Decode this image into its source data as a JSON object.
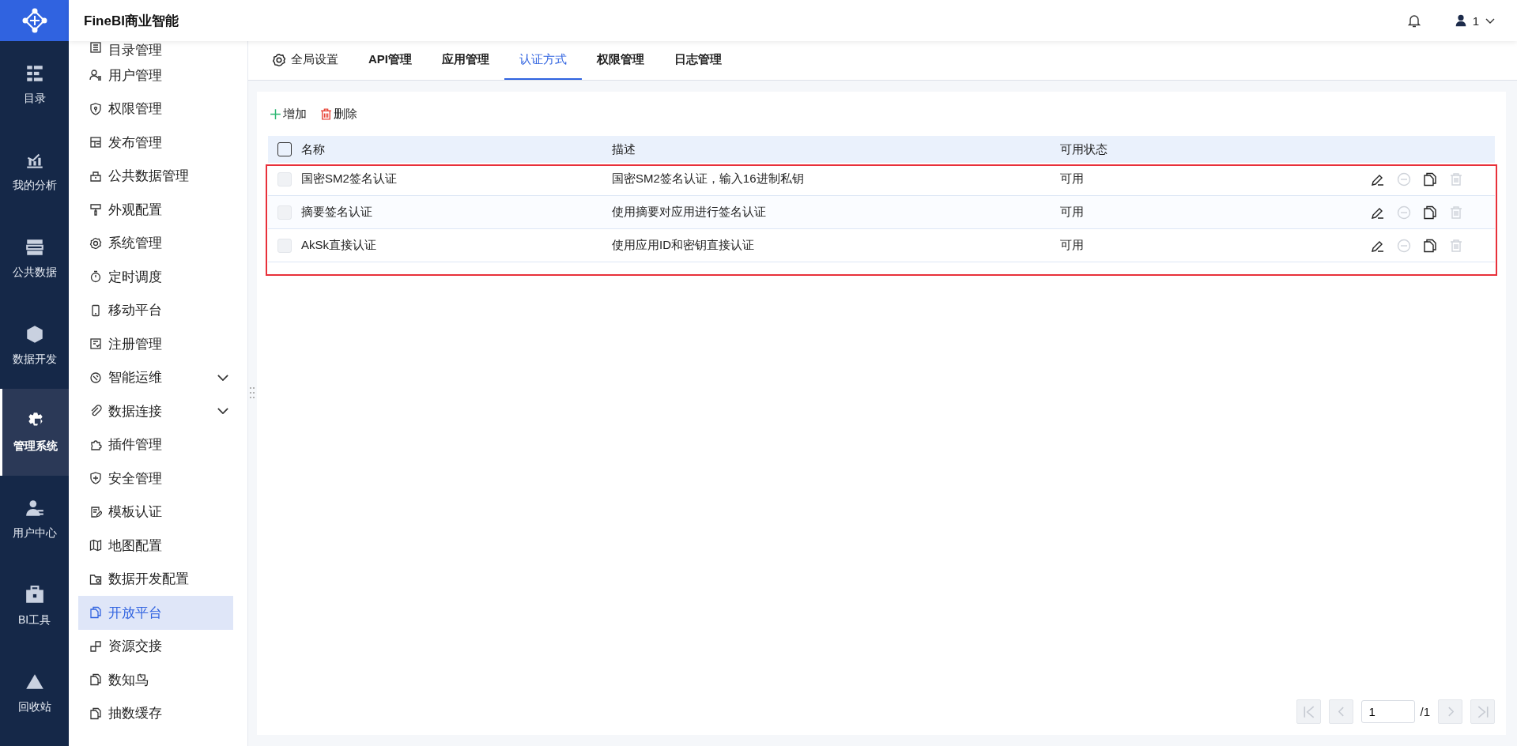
{
  "app": {
    "title": "FineBI商业智能"
  },
  "header": {
    "user": "1"
  },
  "rail": [
    {
      "label": "目录",
      "selected": false
    },
    {
      "label": "我的分析",
      "selected": false
    },
    {
      "label": "公共数据",
      "selected": false
    },
    {
      "label": "数据开发",
      "selected": false
    },
    {
      "label": "管理系统",
      "selected": true
    },
    {
      "label": "用户中心",
      "selected": false
    },
    {
      "label": "BI工具",
      "selected": false
    },
    {
      "label": "回收站",
      "selected": false
    }
  ],
  "menu": [
    {
      "label": "目录管理",
      "selected": false,
      "expandable": false
    },
    {
      "label": "用户管理",
      "selected": false,
      "expandable": false
    },
    {
      "label": "权限管理",
      "selected": false,
      "expandable": false
    },
    {
      "label": "发布管理",
      "selected": false,
      "expandable": false
    },
    {
      "label": "公共数据管理",
      "selected": false,
      "expandable": false
    },
    {
      "label": "外观配置",
      "selected": false,
      "expandable": false
    },
    {
      "label": "系统管理",
      "selected": false,
      "expandable": false
    },
    {
      "label": "定时调度",
      "selected": false,
      "expandable": false
    },
    {
      "label": "移动平台",
      "selected": false,
      "expandable": false
    },
    {
      "label": "注册管理",
      "selected": false,
      "expandable": false
    },
    {
      "label": "智能运维",
      "selected": false,
      "expandable": true
    },
    {
      "label": "数据连接",
      "selected": false,
      "expandable": true
    },
    {
      "label": "插件管理",
      "selected": false,
      "expandable": false
    },
    {
      "label": "安全管理",
      "selected": false,
      "expandable": false
    },
    {
      "label": "模板认证",
      "selected": false,
      "expandable": false
    },
    {
      "label": "地图配置",
      "selected": false,
      "expandable": false
    },
    {
      "label": "数据开发配置",
      "selected": false,
      "expandable": false
    },
    {
      "label": "开放平台",
      "selected": true,
      "expandable": false
    },
    {
      "label": "资源交接",
      "selected": false,
      "expandable": false
    },
    {
      "label": "数知鸟",
      "selected": false,
      "expandable": false
    },
    {
      "label": "抽数缓存",
      "selected": false,
      "expandable": false
    }
  ],
  "tabs": [
    {
      "label": "全局设置",
      "kind": "settings",
      "selected": false
    },
    {
      "label": "API管理",
      "kind": "plain",
      "selected": false
    },
    {
      "label": "应用管理",
      "kind": "plain",
      "selected": false
    },
    {
      "label": "认证方式",
      "kind": "plain",
      "selected": true
    },
    {
      "label": "权限管理",
      "kind": "plain",
      "selected": false
    },
    {
      "label": "日志管理",
      "kind": "plain",
      "selected": false
    }
  ],
  "toolbar": [
    {
      "label": "增加",
      "kind": "add"
    },
    {
      "label": "删除",
      "kind": "delete"
    }
  ],
  "table": {
    "columns": [
      "名称",
      "描述",
      "可用状态"
    ],
    "all_checked": false,
    "rows": [
      {
        "name": "国密SM2签名认证",
        "description": "国密SM2签名认证，输入16进制私钥",
        "status": "可用",
        "checked": false,
        "checkable": false,
        "actions": [
          {
            "kind": "edit",
            "disabled": false
          },
          {
            "kind": "disable",
            "disabled": true
          },
          {
            "kind": "copy",
            "disabled": false
          },
          {
            "kind": "delete",
            "disabled": true
          }
        ]
      },
      {
        "name": "摘要签名认证",
        "description": "使用摘要对应用进行签名认证",
        "status": "可用",
        "checked": false,
        "checkable": false,
        "actions": [
          {
            "kind": "edit",
            "disabled": false
          },
          {
            "kind": "disable",
            "disabled": true
          },
          {
            "kind": "copy",
            "disabled": false
          },
          {
            "kind": "delete",
            "disabled": true
          }
        ]
      },
      {
        "name": "AkSk直接认证",
        "description": "使用应用ID和密钥直接认证",
        "status": "可用",
        "checked": false,
        "checkable": false,
        "actions": [
          {
            "kind": "edit",
            "disabled": false
          },
          {
            "kind": "disable",
            "disabled": true
          },
          {
            "kind": "copy",
            "disabled": false
          },
          {
            "kind": "delete",
            "disabled": true
          }
        ]
      }
    ]
  },
  "pagination": {
    "page": "1",
    "total": "/1",
    "buttons": [
      {
        "kind": "first",
        "disabled": true
      },
      {
        "kind": "prev",
        "disabled": true
      },
      {
        "kind": "next",
        "disabled": true
      },
      {
        "kind": "last",
        "disabled": true
      }
    ]
  }
}
